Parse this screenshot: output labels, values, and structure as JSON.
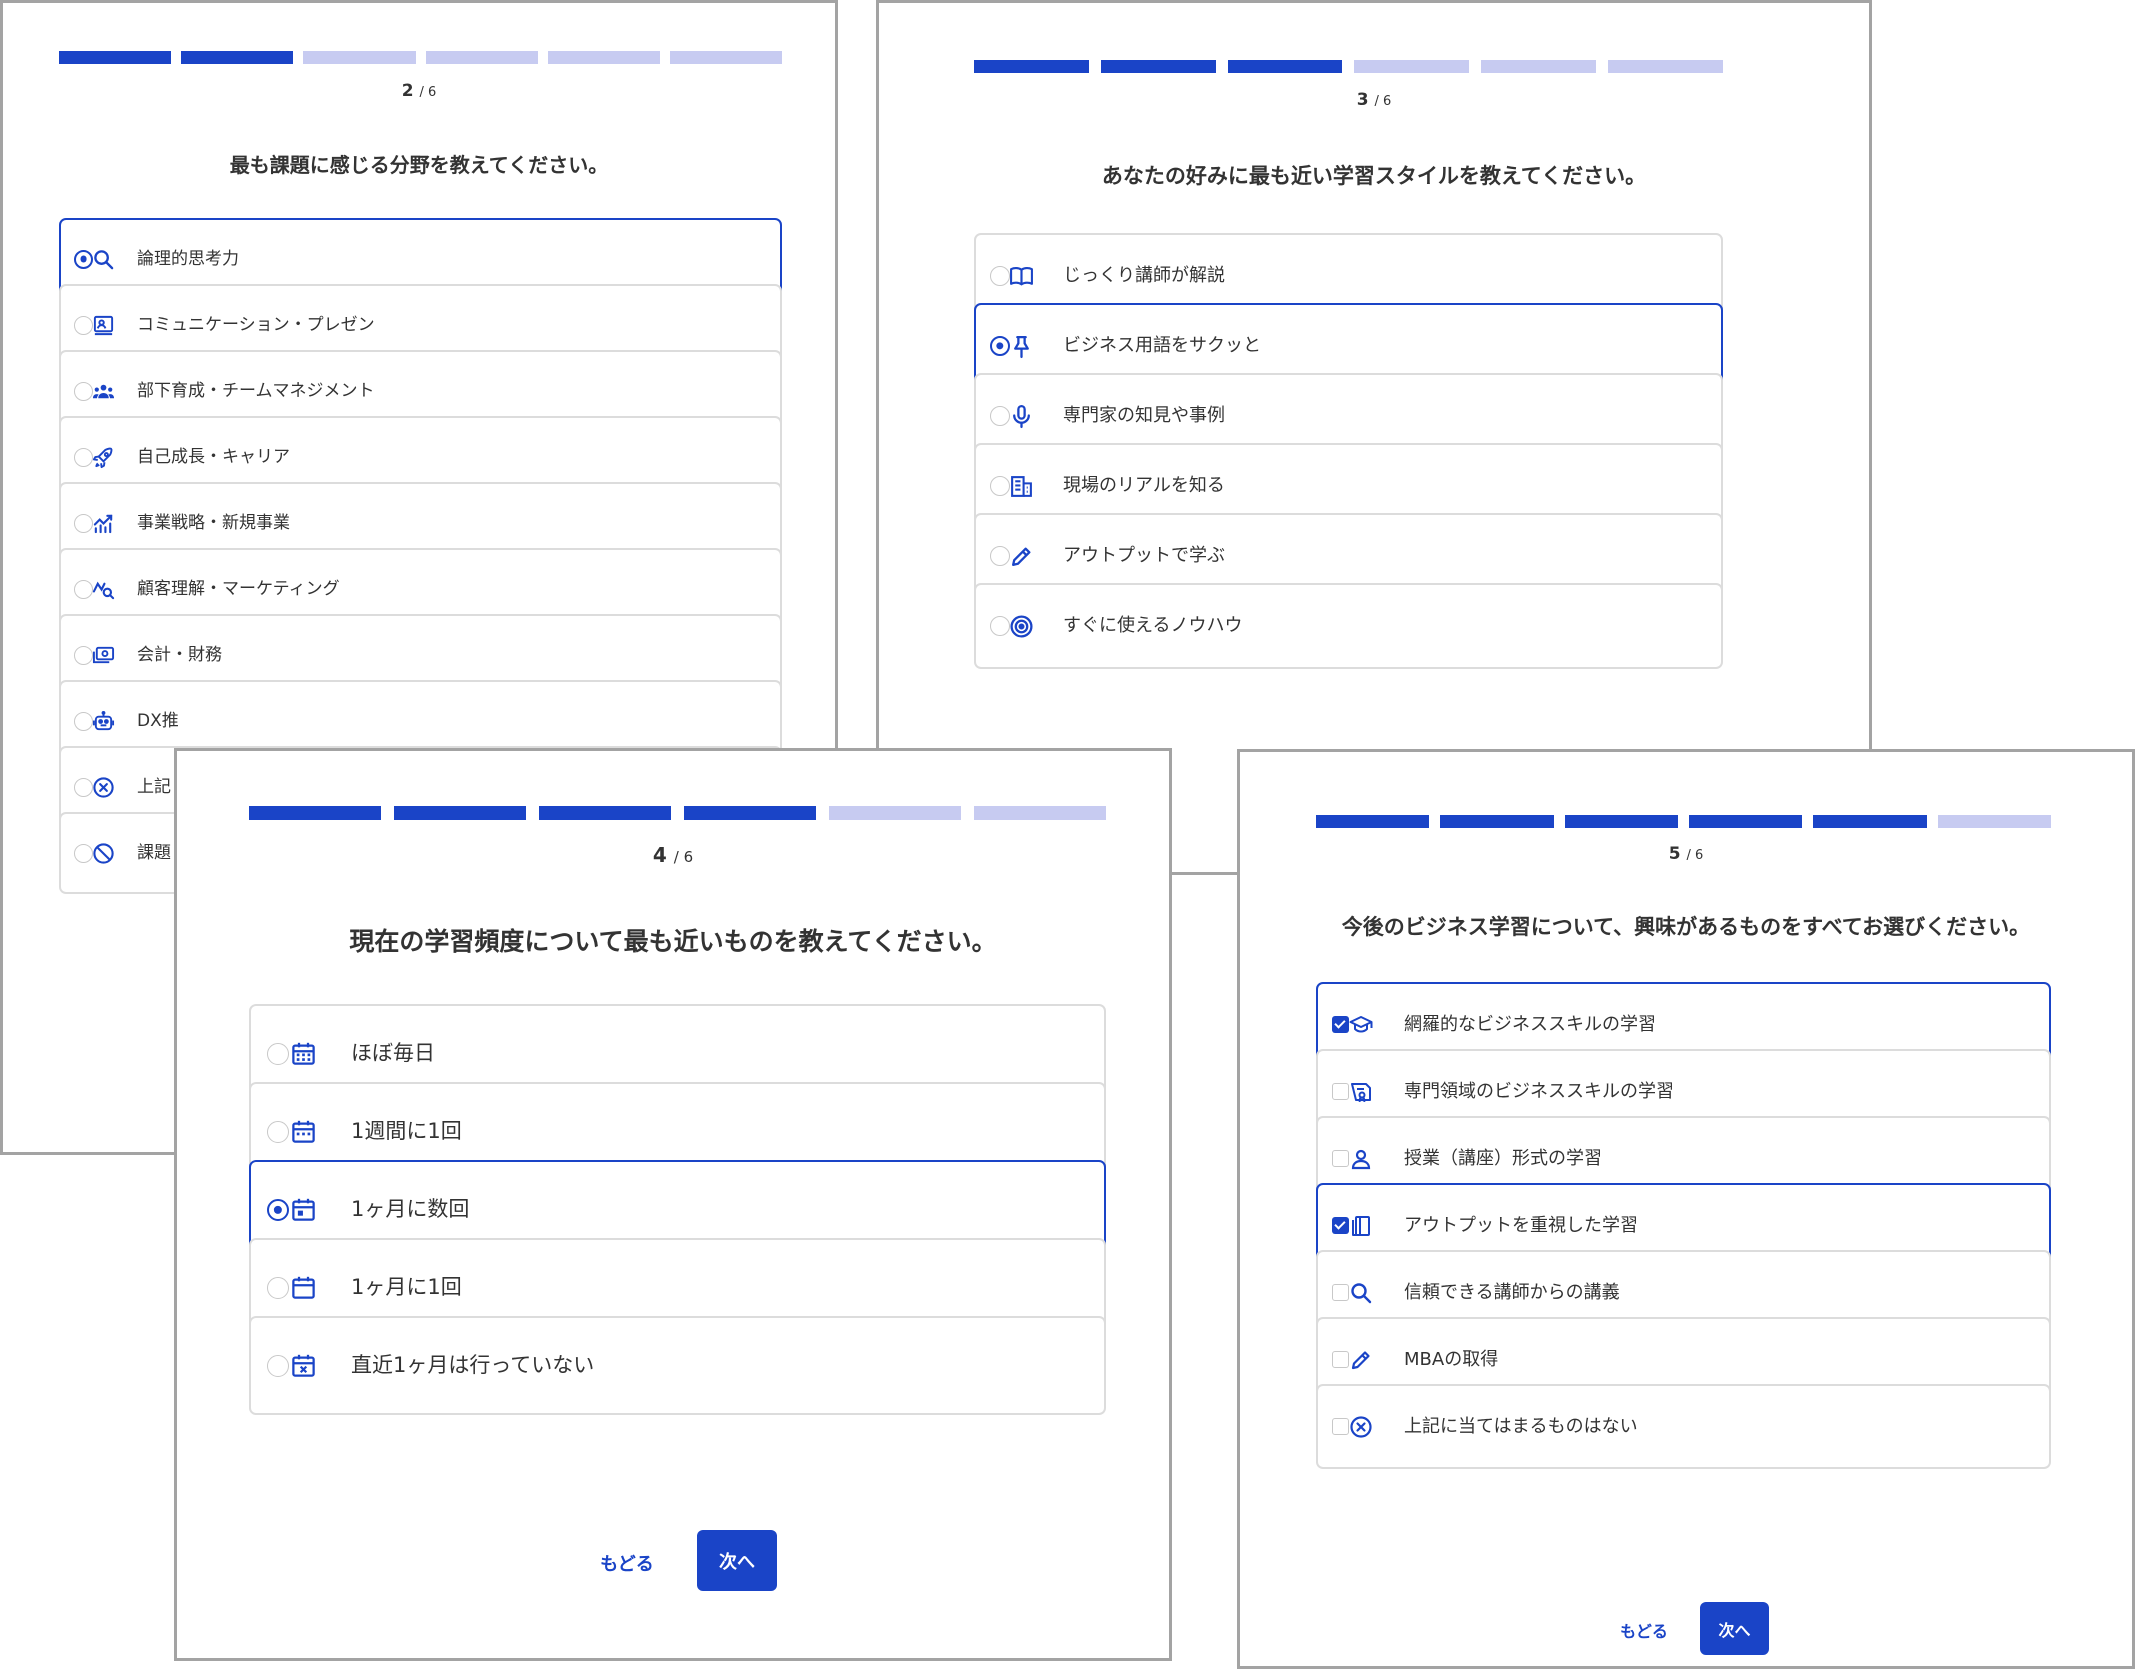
{
  "colors": {
    "accent": "#1a44c7",
    "progress_off": "#c7cbf1",
    "border": "#dcdcdc"
  },
  "panels": [
    {
      "step_current": "2",
      "step_total": "/ 6",
      "progress_filled": 2,
      "progress_total": 6,
      "question": "最も課題に感じる分野を教えてください。",
      "control": "radio",
      "options": [
        {
          "label": "論理的思考力",
          "icon": "search-icon",
          "selected": true
        },
        {
          "label": "コミュニケーション・プレゼン",
          "icon": "presentation-icon",
          "selected": false
        },
        {
          "label": "部下育成・チームマネジメント",
          "icon": "team-icon",
          "selected": false
        },
        {
          "label": "自己成長・キャリア",
          "icon": "rocket-icon",
          "selected": false
        },
        {
          "label": "事業戦略・新規事業",
          "icon": "chart-growth-icon",
          "selected": false
        },
        {
          "label": "顧客理解・マーケティング",
          "icon": "chart-search-icon",
          "selected": false
        },
        {
          "label": "会計・財務",
          "icon": "money-icon",
          "selected": false
        },
        {
          "label": "DX推",
          "icon": "robot-icon",
          "selected": false
        },
        {
          "label": "上記",
          "icon": "cancel-circle-icon",
          "selected": false
        },
        {
          "label": "課題",
          "icon": "block-icon",
          "selected": false
        }
      ]
    },
    {
      "step_current": "3",
      "step_total": "/ 6",
      "progress_filled": 3,
      "progress_total": 6,
      "question": "あなたの好みに最も近い学習スタイルを教えてください。",
      "control": "radio",
      "options": [
        {
          "label": "じっくり講師が解説",
          "icon": "book-icon",
          "selected": false
        },
        {
          "label": "ビジネス用語をサクッと",
          "icon": "pin-icon",
          "selected": true
        },
        {
          "label": "専門家の知見や事例",
          "icon": "mic-icon",
          "selected": false
        },
        {
          "label": "現場のリアルを知る",
          "icon": "building-icon",
          "selected": false
        },
        {
          "label": "アウトプットで学ぶ",
          "icon": "pencil-icon",
          "selected": false
        },
        {
          "label": "すぐに使えるノウハウ",
          "icon": "target-icon",
          "selected": false
        }
      ]
    },
    {
      "step_current": "4",
      "step_total": "/ 6",
      "progress_filled": 4,
      "progress_total": 6,
      "question": "現在の学習頻度について最も近いものを教えてください。",
      "control": "radio",
      "options": [
        {
          "label": "ほぼ毎日",
          "icon": "calendar-month-icon",
          "selected": false
        },
        {
          "label": "1週間に1回",
          "icon": "calendar-week-icon",
          "selected": false
        },
        {
          "label": "1ヶ月に数回",
          "icon": "calendar-day-icon",
          "selected": true
        },
        {
          "label": "1ヶ月に1回",
          "icon": "calendar-icon",
          "selected": false
        },
        {
          "label": "直近1ヶ月は行っていない",
          "icon": "calendar-x-icon",
          "selected": false
        }
      ],
      "back_label": "もどる",
      "next_label": "次へ"
    },
    {
      "step_current": "5",
      "step_total": "/ 6",
      "progress_filled": 5,
      "progress_total": 6,
      "question": "今後のビジネス学習について、興味があるものをすべてお選びください。",
      "control": "checkbox",
      "options": [
        {
          "label": "網羅的なビジネススキルの学習",
          "icon": "graduation-cap-icon",
          "selected": true
        },
        {
          "label": "専門領域のビジネススキルの学習",
          "icon": "diploma-icon",
          "selected": false
        },
        {
          "label": "授業（講座）形式の学習",
          "icon": "person-icon",
          "selected": false
        },
        {
          "label": "アウトプットを重視した学習",
          "icon": "notebook-icon",
          "selected": true
        },
        {
          "label": "信頼できる講師からの講義",
          "icon": "search-icon",
          "selected": false
        },
        {
          "label": "MBAの取得",
          "icon": "pencil-icon",
          "selected": false
        },
        {
          "label": "上記に当てはまるものはない",
          "icon": "cancel-circle-icon",
          "selected": false
        }
      ],
      "back_label": "もどる",
      "next_label": "次へ"
    }
  ]
}
